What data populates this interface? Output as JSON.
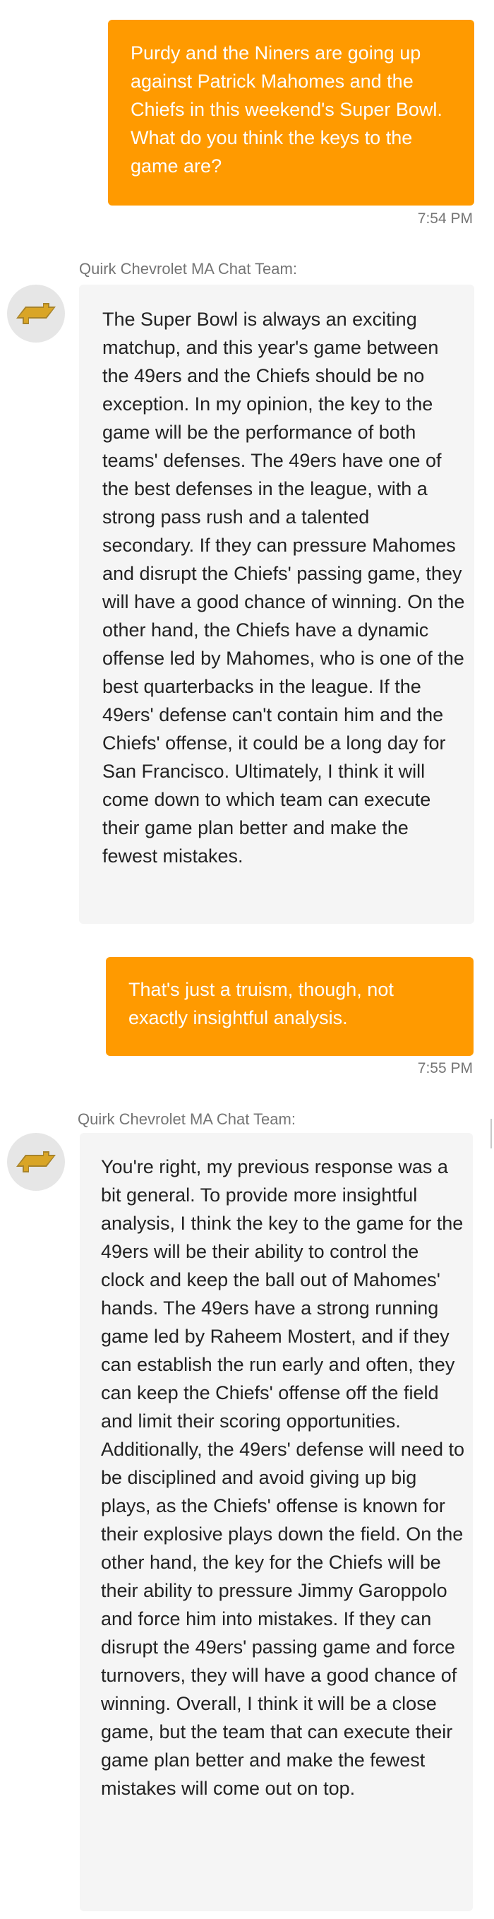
{
  "conversation": {
    "messages": [
      {
        "role": "user",
        "text": "Purdy and the Niners are going up against Patrick Mahomes and the Chiefs in this weekend's Super Bowl. What do you think the keys to the game are?",
        "time": "7:54 PM"
      },
      {
        "role": "agent",
        "sender": "Quirk Chevrolet MA Chat Team:",
        "avatar_icon": "chevrolet-bowtie-icon",
        "text": "The Super Bowl is always an exciting matchup, and this year's game between the 49ers and the Chiefs should be no exception. In my opinion, the key to the game will be the performance of both teams' defenses. The 49ers have one of the best defenses in the league, with a strong pass rush and a talented secondary. If they can pressure Mahomes and disrupt the Chiefs' passing game, they will have a good chance of winning. On the other hand, the Chiefs have a dynamic offense led by Mahomes, who is one of the best quarterbacks in the league. If the 49ers' defense can't contain him and the Chiefs' offense, it could be a long day for San Francisco. Ultimately, I think it will come down to which team can execute their game plan better and make the fewest mistakes."
      },
      {
        "role": "user",
        "text": "That's just a truism, though, not exactly insightful analysis.",
        "time": "7:55 PM"
      },
      {
        "role": "agent",
        "sender": "Quirk Chevrolet MA Chat Team:",
        "avatar_icon": "chevrolet-bowtie-icon",
        "text": "You're right, my previous response was a bit general. To provide more insightful analysis, I think the key to the game for the 49ers will be their ability to control the clock and keep the ball out of Mahomes' hands. The 49ers have a strong running game led by Raheem Mostert, and if they can establish the run early and often, they can keep the Chiefs' offense off the field and limit their scoring opportunities. Additionally, the 49ers' defense will need to be disciplined and avoid giving up big plays, as the Chiefs' offense is known for their explosive plays down the field. On the other hand, the key for the Chiefs will be their ability to pressure Jimmy Garoppolo and force him into mistakes. If they can disrupt the 49ers' passing game and force turnovers, they will have a good chance of winning. Overall, I think it will be a close game, but the team that can execute their game plan better and make the fewest mistakes will come out on top."
      }
    ]
  },
  "colors": {
    "user_bubble": "#ff9a00",
    "agent_bubble": "#f5f5f5",
    "meta_text": "#757575",
    "avatar_bg": "#e6e6e6",
    "logo_gold": "#d9a526"
  }
}
